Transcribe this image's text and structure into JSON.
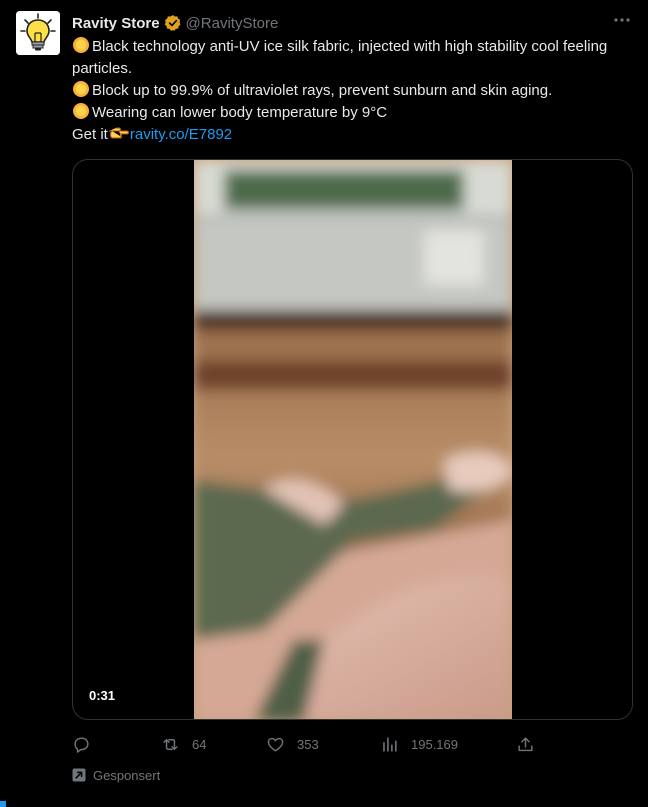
{
  "author": {
    "display_name": "Ravity Store",
    "handle": "@RavityStore",
    "avatar_icon": "lightbulb-icon",
    "verified_color": "#e0a21b"
  },
  "tweet": {
    "line1": "Black technology anti-UV ice silk fabric, injected with high stability cool feeling particles.",
    "line2": "Block up to 99.9% of ultraviolet rays, prevent sunburn and skin aging.",
    "line3": "Wearing can lower body temperature by 9°C",
    "line4_prefix": "Get it",
    "link_text": "ravity.co/E7892"
  },
  "media": {
    "duration": "0:31"
  },
  "actions": {
    "reply_icon": "reply-icon",
    "retweet_count": "64",
    "like_count": "353",
    "views_count": "195.169",
    "share_icon": "share-icon"
  },
  "footer": {
    "sponsored_label": "Gesponsert"
  },
  "colors": {
    "link": "#1d9bf0",
    "muted": "#71767b",
    "text": "#e7e9ea",
    "background": "#000000"
  }
}
